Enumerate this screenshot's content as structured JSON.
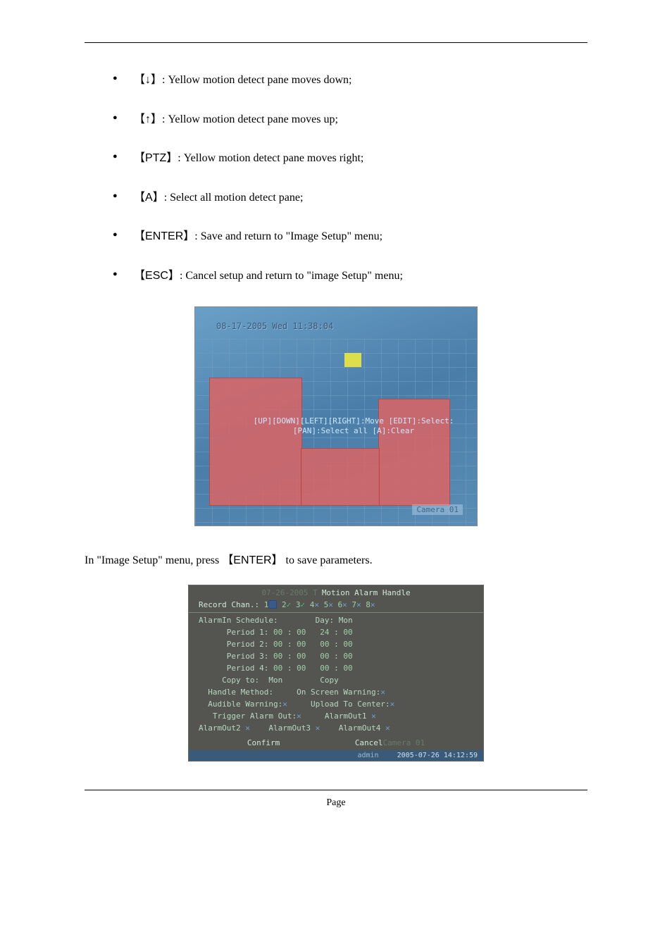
{
  "bullets": [
    {
      "key": "↓",
      "text": ": Yellow motion detect pane moves down;"
    },
    {
      "key": "↑",
      "text": ": Yellow motion detect pane moves up;"
    },
    {
      "key": "PTZ",
      "text": ": Yellow motion detect pane moves right;"
    },
    {
      "key": "A",
      "text": ": Select all motion detect pane;"
    },
    {
      "key": "ENTER",
      "text": ": Save and return to \"Image Setup\" menu;"
    },
    {
      "key": "ESC",
      "text": ": Cancel setup and return to \"image Setup\" menu;"
    }
  ],
  "screenshot1": {
    "timestamp": "08-17-2005 Wed 11:38:04",
    "hint_line1": "[UP][DOWN][LEFT][RIGHT]:Move [EDIT]:Select:",
    "hint_line2": "[PAN]:Select all [A]:Clear",
    "camera_label": "Camera 01"
  },
  "policy_paragraph": {
    "prefix": "In \"Image Setup\" menu, press",
    "key": "ENTER",
    "suffix": "to save parameters."
  },
  "screenshot2": {
    "ghost_date": "07-26-2005 T",
    "title": "Motion Alarm Handle",
    "record_chan_label": "Record Chan.:",
    "channels": [
      {
        "n": "1",
        "mark": "sel"
      },
      {
        "n": "2",
        "mark": "check"
      },
      {
        "n": "3",
        "mark": "check"
      },
      {
        "n": "4",
        "mark": "cross"
      },
      {
        "n": "5",
        "mark": "cross"
      },
      {
        "n": "6",
        "mark": "cross"
      },
      {
        "n": "7",
        "mark": "cross"
      },
      {
        "n": "8",
        "mark": "cross"
      }
    ],
    "alarmin_schedule_label": "AlarmIn Schedule:",
    "day_label": "Day:",
    "day_value": "Mon",
    "periods": [
      {
        "label": "Period 1:",
        "h1": "00",
        "m1": "00",
        "h2": "24",
        "m2": "00"
      },
      {
        "label": "Period 2:",
        "h1": "00",
        "m1": "00",
        "h2": "00",
        "m2": "00"
      },
      {
        "label": "Period 3:",
        "h1": "00",
        "m1": "00",
        "h2": "00",
        "m2": "00"
      },
      {
        "label": "Period 4:",
        "h1": "00",
        "m1": "00",
        "h2": "00",
        "m2": "00"
      }
    ],
    "copy_to_label": "Copy to:",
    "copy_to_value": "Mon",
    "copy_btn": "Copy",
    "handle_method_label": "Handle Method:",
    "onscreen_label": "On Screen Warning:",
    "audible_label": "Audible Warning:",
    "upload_label": "Upload To Center:",
    "trigger_label": "Trigger Alarm Out:",
    "alarmout1": "AlarmOut1",
    "alarmout2": "AlarmOut2",
    "alarmout3": "AlarmOut3",
    "alarmout4": "AlarmOut4",
    "confirm": "Confirm",
    "cancel": "Cancel",
    "ghost_cam": "Camera 01",
    "status_admin": "admin",
    "status_time": "2005-07-26 14:12:59"
  },
  "footer": "Page"
}
